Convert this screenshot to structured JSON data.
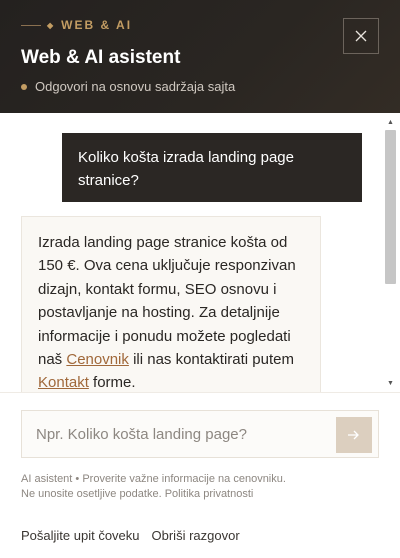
{
  "header": {
    "eyebrow": "WEB & AI",
    "title": "Web & AI asistent",
    "subtitle": "Odgovori na osnovu sadržaja sajta",
    "close_icon": "close-icon"
  },
  "messages": {
    "user": "Koliko košta izrada landing page stranice?",
    "assistant": {
      "text_before": "Izrada landing page stranice košta od 150 €. Ova cena uključuje responzivan dizajn, kontakt formu, SEO osnovu i postavljanje na hosting. Za detaljnije informacije i ponudu možete pogledati naš ",
      "link1": "Cenovnik",
      "text_middle": " ili nas kontaktirati putem ",
      "link2": "Kontakt",
      "text_after": " forme."
    }
  },
  "composer": {
    "placeholder": "Npr. Koliko košta landing page?",
    "send_icon": "arrow-right-icon"
  },
  "disclaimer": "AI asistent • Proverite važne informacije na cenovniku. Ne unosite osetljive podatke. Politika privatnosti",
  "actions": {
    "send_to_human": "Pošaljite upit čoveku",
    "clear_chat": "Obriši razgovor"
  },
  "colors": {
    "header_bg": "#24211f",
    "accent": "#c39d63",
    "link": "#a0683a",
    "user_bubble": "#2b2724",
    "send_button": "#dccfbf"
  }
}
